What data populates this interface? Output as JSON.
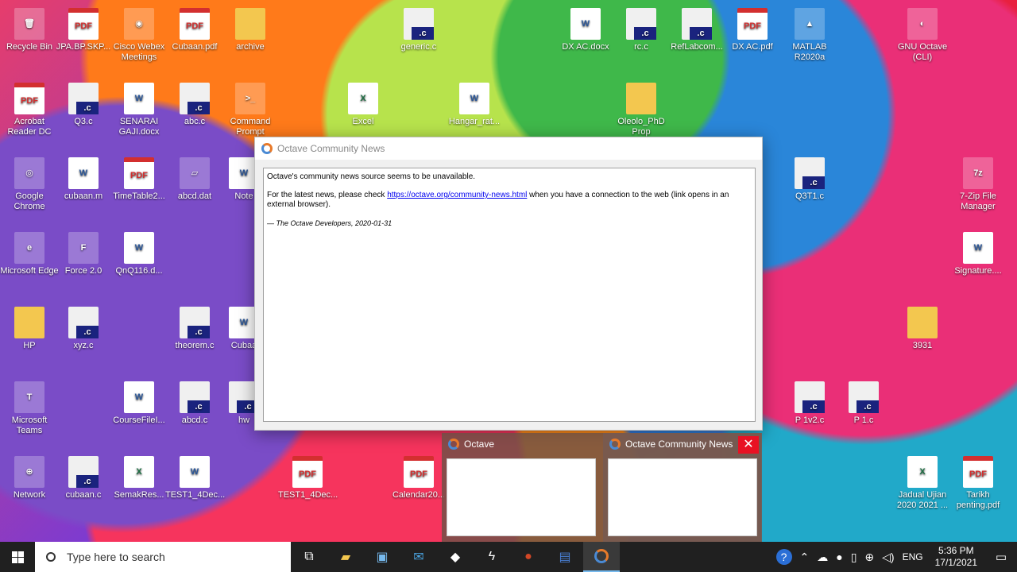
{
  "desktop_icons": [
    {
      "label": "Recycle Bin",
      "type": "app",
      "glyph": "🗑"
    },
    {
      "label": "JPA.BP.SKP...",
      "type": "pdf"
    },
    {
      "label": "Cisco Webex Meetings",
      "type": "app",
      "glyph": "◉"
    },
    {
      "label": "Cubaan.pdf",
      "type": "pdf"
    },
    {
      "label": "archive",
      "type": "folder"
    },
    {
      "label": "generic.c",
      "type": "c"
    },
    {
      "label": "DX AC.docx",
      "type": "doc"
    },
    {
      "label": "rc.c",
      "type": "c"
    },
    {
      "label": "RefLabcom...",
      "type": "c"
    },
    {
      "label": "DX AC.pdf",
      "type": "pdf"
    },
    {
      "label": "MATLAB R2020a",
      "type": "app",
      "glyph": "▲"
    },
    {
      "label": "GNU Octave (CLI)",
      "type": "app",
      "glyph": "◐"
    },
    {
      "label": "Acrobat Reader DC",
      "type": "pdf"
    },
    {
      "label": "Q3.c",
      "type": "c"
    },
    {
      "label": "SENARAI GAJI.docx",
      "type": "doc"
    },
    {
      "label": "abc.c",
      "type": "c"
    },
    {
      "label": "Command Prompt",
      "type": "app",
      "glyph": ">_"
    },
    {
      "label": "Excel",
      "type": "xls"
    },
    {
      "label": "Hangar_rat...",
      "type": "doc"
    },
    {
      "label": "Oleolo_PhD Prop",
      "type": "folder"
    },
    {
      "label": "Google Chrome",
      "type": "app",
      "glyph": "◎"
    },
    {
      "label": "cubaan.m",
      "type": "doc"
    },
    {
      "label": "TimeTable2...",
      "type": "pdf"
    },
    {
      "label": "abcd.dat",
      "type": "app",
      "glyph": "▱"
    },
    {
      "label": "Note",
      "type": "doc"
    },
    {
      "label": "Q3T1.c",
      "type": "c"
    },
    {
      "label": "7-Zip File Manager",
      "type": "app",
      "glyph": "7z"
    },
    {
      "label": "Microsoft Edge",
      "type": "app",
      "glyph": "e"
    },
    {
      "label": "Force 2.0",
      "type": "app",
      "glyph": "F"
    },
    {
      "label": "QnQ116.d...",
      "type": "doc"
    },
    {
      "label": "Signature....",
      "type": "doc"
    },
    {
      "label": "HP",
      "type": "folder"
    },
    {
      "label": "xyz.c",
      "type": "c"
    },
    {
      "label": "theorem.c",
      "type": "c"
    },
    {
      "label": "Cubaa",
      "type": "doc"
    },
    {
      "label": "3931",
      "type": "folder"
    },
    {
      "label": "Microsoft Teams",
      "type": "app",
      "glyph": "T"
    },
    {
      "label": "CourseFileI...",
      "type": "doc"
    },
    {
      "label": "abcd.c",
      "type": "c"
    },
    {
      "label": "hw",
      "type": "c"
    },
    {
      "label": "P 1v2.c",
      "type": "c"
    },
    {
      "label": "P 1.c",
      "type": "c"
    },
    {
      "label": "Network",
      "type": "app",
      "glyph": "⊕"
    },
    {
      "label": "cubaan.c",
      "type": "c"
    },
    {
      "label": "SemakRes...",
      "type": "xls"
    },
    {
      "label": "TEST1_4Dec...",
      "type": "doc"
    },
    {
      "label": "TEST1_4Dec...",
      "type": "pdf"
    },
    {
      "label": "Calendar20...",
      "type": "pdf"
    },
    {
      "label": "Jadual Ujian 2020 2021 ...",
      "type": "xls"
    },
    {
      "label": "Tarikh penting.pdf",
      "type": "pdf"
    }
  ],
  "dialog": {
    "title": "Octave Community News",
    "line1": "Octave's community news source seems to be unavailable.",
    "line2_pre": "For the latest news, please check ",
    "link": "https://octave.org/community-news.html",
    "line2_post": " when you have a connection to the web (link opens in an external browser).",
    "signature": "— The Octave Developers, 2020-01-31"
  },
  "thumbnails": [
    {
      "title": "Octave"
    },
    {
      "title": "Octave Community News",
      "close": "✕"
    }
  ],
  "taskbar": {
    "search_placeholder": "Type here to search",
    "apps": [
      "task-view",
      "file-explorer",
      "store",
      "mail",
      "dropbox",
      "bolt",
      "powerpoint",
      "word",
      "octave"
    ],
    "language": "ENG",
    "time": "5:36 PM",
    "date": "17/1/2021"
  }
}
